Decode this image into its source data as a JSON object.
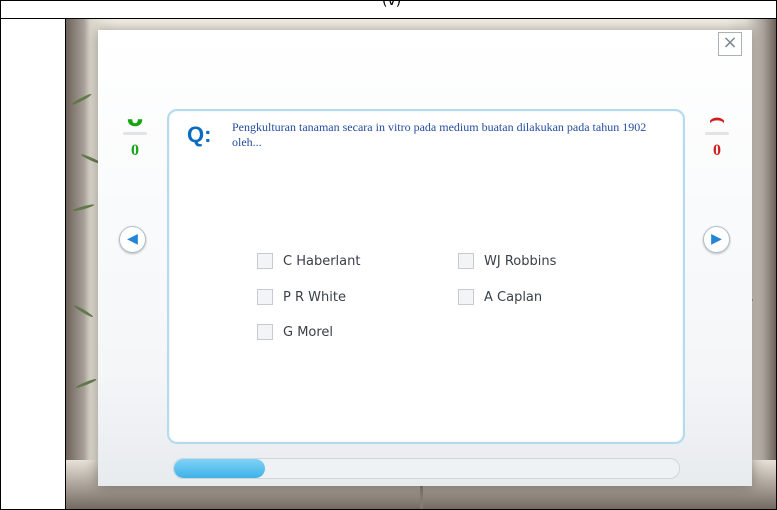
{
  "top_fragment": "(v)",
  "modal": {
    "close_icon": "×",
    "question": {
      "marker": "Q:",
      "text": "Pengkulturan tanaman secara in vitro pada medium buatan dilakukan pada tahun 1902 oleh..."
    },
    "answers": [
      {
        "label": "C Haberlant",
        "checked": false
      },
      {
        "label": "WJ Robbins",
        "checked": false
      },
      {
        "label": "P R White",
        "checked": false
      },
      {
        "label": "A Caplan",
        "checked": false
      },
      {
        "label": "G Morel",
        "checked": false
      }
    ],
    "correct_score": "0",
    "incorrect_score": "0",
    "progress_fraction": 0.18
  },
  "colors": {
    "correct_green": "#17a414",
    "incorrect_red": "#d21b1b",
    "accent_blue": "#0a6bc0"
  },
  "icons": {
    "correct": "smile-icon",
    "incorrect": "frown-icon",
    "previous": "previous-arrow-icon",
    "next": "next-arrow-icon",
    "close": "close-icon"
  }
}
